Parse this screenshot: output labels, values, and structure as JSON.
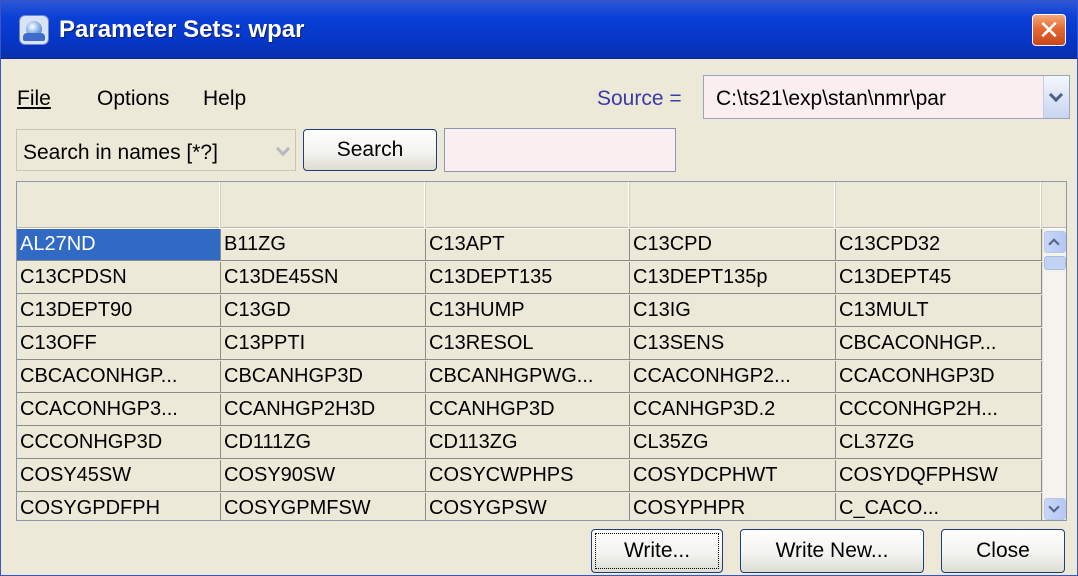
{
  "window": {
    "title": "Parameter Sets: wpar",
    "close_symbol": "✕",
    "title_color": "#0a3fd6"
  },
  "menu": [
    {
      "label": "File"
    },
    {
      "label": "Options"
    },
    {
      "label": "Help"
    }
  ],
  "source": {
    "label": "Source =",
    "value": "C:\\ts21\\exp\\stan\\nmr\\par"
  },
  "search": {
    "mode": "Search in names [*?]",
    "button": "Search",
    "query": ""
  },
  "table": {
    "selected": "AL27ND",
    "rows": [
      [
        "AL27ND",
        "B11ZG",
        "C13APT",
        "C13CPD",
        "C13CPD32"
      ],
      [
        "C13CPDSN",
        "C13DE45SN",
        "C13DEPT135",
        "C13DEPT135p",
        "C13DEPT45"
      ],
      [
        "C13DEPT90",
        "C13GD",
        "C13HUMP",
        "C13IG",
        "C13MULT"
      ],
      [
        "C13OFF",
        "C13PPTI",
        "C13RESOL",
        "C13SENS",
        "CBCACONHGP..."
      ],
      [
        "CBCACONHGP...",
        "CBCANHGP3D",
        "CBCANHGPWG...",
        "CCACONHGP2...",
        "CCACONHGP3D"
      ],
      [
        "CCACONHGP3...",
        "CCANHGP2H3D",
        "CCANHGP3D",
        "CCANHGP3D.2",
        "CCCONHGP2H..."
      ],
      [
        "CCCONHGP3D",
        "CD111ZG",
        "CD113ZG",
        "CL35ZG",
        "CL37ZG"
      ],
      [
        "COSY45SW",
        "COSY90SW",
        "COSYCWPHPS",
        "COSYDCPHWT",
        "COSYDQFPHSW"
      ],
      [
        "COSYGPDFPH",
        "COSYGPMFSW",
        "COSYGPSW",
        "COSYPHPR",
        "C_CACO..."
      ]
    ]
  },
  "buttons": {
    "write": "Write...",
    "write_new": "Write New...",
    "close": "Close"
  }
}
